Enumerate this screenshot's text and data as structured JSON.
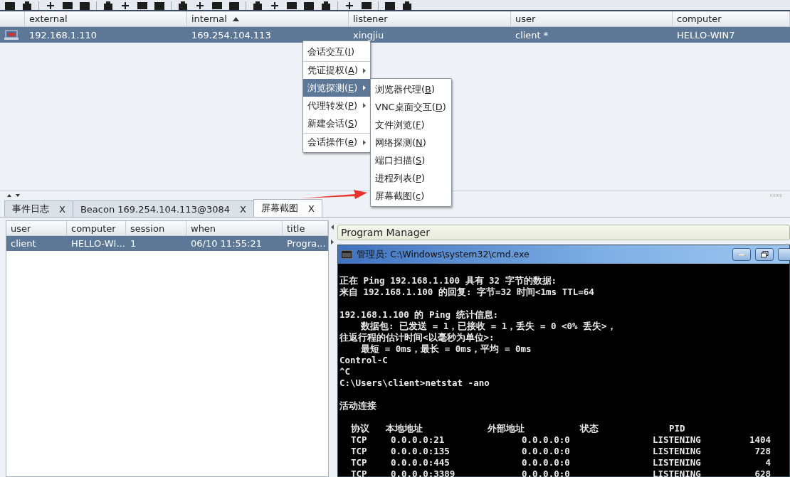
{
  "sessions_table": {
    "columns": [
      {
        "label": "external",
        "sorted": false
      },
      {
        "label": "internal",
        "sorted": true
      },
      {
        "label": "listener",
        "sorted": false
      },
      {
        "label": "user",
        "sorted": false
      },
      {
        "label": "computer",
        "sorted": false
      }
    ],
    "rows": [
      {
        "selected": true,
        "cells": [
          "192.168.1.110",
          "169.254.104.113",
          "xingjiu",
          "client *",
          "HELLO-WIN7"
        ]
      }
    ]
  },
  "context_menu": {
    "items": [
      {
        "label": "会话交互(I)",
        "submenu": false,
        "selected": false,
        "divider_before": false
      },
      {
        "label": "凭证提权(A)",
        "submenu": true,
        "selected": false,
        "divider_before": true
      },
      {
        "label": "浏览探测(E)",
        "submenu": true,
        "selected": true,
        "divider_before": false
      },
      {
        "label": "代理转发(P)",
        "submenu": true,
        "selected": false,
        "divider_before": false
      },
      {
        "label": "新建会话(S)",
        "submenu": false,
        "selected": false,
        "divider_before": false
      },
      {
        "label": "会话操作(e)",
        "submenu": true,
        "selected": false,
        "divider_before": true
      }
    ],
    "submenu": [
      {
        "label": "浏览器代理(B)"
      },
      {
        "label": "VNC桌面交互(D)"
      },
      {
        "label": "文件浏览(F)"
      },
      {
        "label": "网络探测(N)"
      },
      {
        "label": "端口扫描(S)"
      },
      {
        "label": "进程列表(P)"
      },
      {
        "label": "屏幕截图(c)"
      }
    ]
  },
  "tabs": [
    {
      "label": "事件日志",
      "close": "X",
      "selected": false
    },
    {
      "label": "Beacon 169.254.104.113@3084",
      "close": "X",
      "selected": false
    },
    {
      "label": "屏幕截图",
      "close": "X",
      "selected": true
    }
  ],
  "screenshots_table": {
    "columns": [
      "user",
      "computer",
      "session",
      "when",
      "title"
    ],
    "rows": [
      {
        "selected": true,
        "cells": [
          "client",
          "HELLO-WI...",
          "1",
          "06/10 11:55:21",
          "Progra..."
        ]
      }
    ]
  },
  "screenshot_view": {
    "window_title": "Program Manager",
    "cmd_window": {
      "title": "管理员: C:\\Windows\\system32\\cmd.exe",
      "paragraphs": [
        [
          "正在 Ping 192.168.1.100 具有 32 字节的数据:",
          "来自 192.168.1.100 的回复: 字节=32 时间<1ms TTL=64"
        ],
        [
          "192.168.1.100 的 Ping 统计信息:",
          "    数据包: 已发送 = 1，已接收 = 1，丢失 = 0 <0% 丢失>，",
          "往返行程的估计时间<以毫秒为单位>:",
          "    最短 = 0ms，最长 = 0ms，平均 = 0ms",
          "Control-C",
          "^C",
          "C:\\Users\\client>netstat -ano"
        ],
        [
          "活动连接"
        ]
      ],
      "netstat": {
        "headers": [
          "协议",
          "本地地址",
          "外部地址",
          "状态",
          "PID"
        ],
        "rows": [
          [
            "TCP",
            "0.0.0.0:21",
            "0.0.0.0:0",
            "LISTENING",
            "1404"
          ],
          [
            "TCP",
            "0.0.0.0:135",
            "0.0.0.0:0",
            "LISTENING",
            "728"
          ],
          [
            "TCP",
            "0.0.0.0:445",
            "0.0.0.0:0",
            "LISTENING",
            "4"
          ],
          [
            "TCP",
            "0.0.0.0:3389",
            "0.0.0.0:0",
            "LISTENING",
            "628"
          ]
        ]
      }
    }
  }
}
